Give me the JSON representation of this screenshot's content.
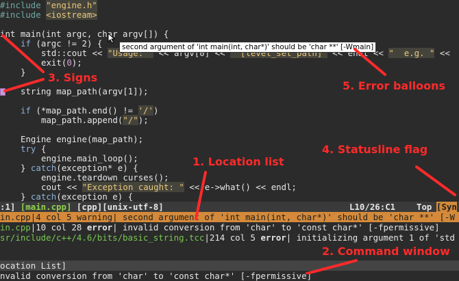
{
  "code": {
    "include1_kw": "#include",
    "include1_str": "\"engine.h\"",
    "include2_kw": "#include",
    "include2_str": "<iostream>",
    "main_sig": "int main(int argc, char argv[]) {",
    "if_argc_kw": "if",
    "if_argc_rest": " (argc != 2) {",
    "cout_pre": "std::cout << ",
    "cout_str1": "\"Usage: \"",
    "cout_mid": " << argv[0] << ",
    "cout_str2": "\" [level_set_path]\"",
    "cout_mid2": " << endl << ",
    "cout_str3": "\"  e.g. \"",
    "cout_end": " <<",
    "exit_call": "exit(",
    "exit_num": "0",
    "exit_end": ");",
    "close_brace": "}",
    "map_path_decl": "string map_path(argv[1]);",
    "if_end_kw": "if",
    "if_end_pre": " (*map_path.end() != ",
    "if_end_str": "'/'",
    "if_end_post": ")",
    "append_pre": "map_path.append(",
    "append_str": "\"/\"",
    "append_post": ");",
    "engine_decl": "Engine engine(map_path);",
    "try_kw": "try",
    "try_rest": " {",
    "main_loop": "engine.main_loop();",
    "catch1_pre": "} ",
    "catch1_kw": "catch",
    "catch1_rest": "(exception* e) {",
    "teardown": "engine.teardown_curses();",
    "cout2_pre": "cout << ",
    "cout2_str": "\"Exception caught: \"",
    "cout2_post": " << e->what() << endl;",
    "catch2_pre": "} ",
    "catch2_kw": "catch",
    "catch2_rest": "(exception e) {"
  },
  "statusline": {
    "left": ":1] ",
    "filename": "[main.cpp]",
    "filetype": " [cpp][unix-utf-8]",
    "position": "L10/26:C1",
    "top": "Top",
    "syntax_flag": "[Syn"
  },
  "location_list": {
    "row1": "in.cpp|4 col 5 warning| second argument of 'int main(int, char*)' should be 'char **' [-W",
    "row2_file": "in.cpp",
    "row2_rest": "|10 col 28 ",
    "row2_err": "error",
    "row2_msg": "| invalid conversion from 'char' to 'const char*' [-fpermissive]",
    "row3_file": "sr/include/c++/4.6/bits/basic_string.tcc",
    "row3_rest": "|214 col 5 ",
    "row3_err": "error",
    "row3_msg": "| initializing argument 1 of 'std"
  },
  "command_window": {
    "title": "ocation List]",
    "line": "nvalid conversion from 'char' to 'const char*' [-fpermissive]"
  },
  "balloon": {
    "text": "second argument of 'int main(int, char*)' should be 'char **' [-Wmain]"
  },
  "annotations": {
    "signs": "3. Signs",
    "error_balloons": "5. Error balloons",
    "statusline_flag": "4. Statusline flag",
    "location_list": "1. Location list",
    "command_window": "2. Command window"
  },
  "colors": {
    "annotation": "#ff2a2a",
    "location_list_highlight": "#d48a3a",
    "sign": "#c59ad8"
  }
}
